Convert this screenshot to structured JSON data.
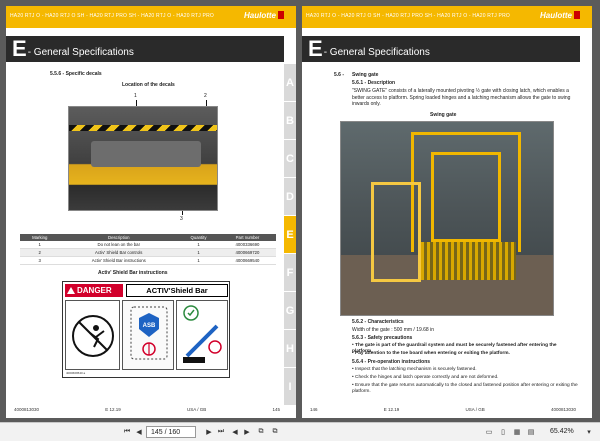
{
  "header": {
    "models": "HA20 RTJ O - HA20 RTJ O SH - HA20 RTJ PRO SH - HA20 RTJ O - HA20 RTJ PRO",
    "brand": "Haulotte"
  },
  "left_page": {
    "section_letter": "E",
    "section_title": "- General Specifications",
    "heading": "5.5.6 - Specific decals",
    "subheading": "Location of the  decals",
    "callouts": [
      "1",
      "2",
      "3"
    ],
    "table": {
      "headers": [
        "Marking",
        "Description",
        "Quantity",
        "Part number"
      ],
      "rows": [
        [
          "1",
          "Do not lean on the bar",
          "1",
          "4000336690"
        ],
        [
          "2",
          "Activ' Shield Bar controls",
          "1",
          "4000669720"
        ],
        [
          "3",
          "Activ' Shield Bar instructions",
          "1",
          "4000669540"
        ]
      ]
    },
    "decal_title": "Activ' Shield Bar instructions",
    "decal": {
      "danger": "DANGER",
      "shield": "ACTIV'Shield Bar",
      "asb": "ASB",
      "code": "4000669540 a"
    },
    "footer": {
      "left": "4000813030",
      "center": "E 12.19",
      "right": "USA / GB",
      "page": "145"
    }
  },
  "right_page": {
    "section_letter": "E",
    "section_title": "- General Specifications",
    "section_num": "5.6 -",
    "section_name": "Swing gate",
    "sub1": "5.6.1 - Description",
    "desc": "\"SWING GATE\" consists of a laterally mounted pivoting ½ gate with closing latch, which enables a better access to platform. Spring loaded hinges and a latching mechanism allows the gate to swing inwards only.",
    "photo_title": "Swing gate",
    "sub2": "5.6.2 - Characteristics",
    "width": "Width of the gate :  500 mm / 19.68 in",
    "sub3": "5.6.3 - Safety precautions",
    "safety": [
      "The gate is part of the guardrail system and must be securely fastened after entering the platform.",
      "Pay attention to the toe board when entering or exiting the platform."
    ],
    "sub4": "5.6.4 - Pre-operation instructions",
    "preop": [
      "Inspect that the latching mechanism is securely fastened.",
      "Check the hinges and latch operate correctly and are not deformed.",
      "Ensure that the gate returns automatically to the closed and fastened position after entering or exiting the platform."
    ],
    "footer": {
      "left": "146",
      "center": "E 12.19",
      "right": "USA / GB",
      "page": "4000813030"
    }
  },
  "tabs": [
    "A",
    "B",
    "C",
    "D",
    "E",
    "F",
    "G",
    "H",
    "I"
  ],
  "active_tab": "E",
  "statusbar": {
    "page_input": "145 / 160",
    "zoom": "65.42%"
  },
  "colors": {
    "accent": "#f5b800",
    "banner": "#2a2a2a",
    "danger": "#d2002b"
  }
}
